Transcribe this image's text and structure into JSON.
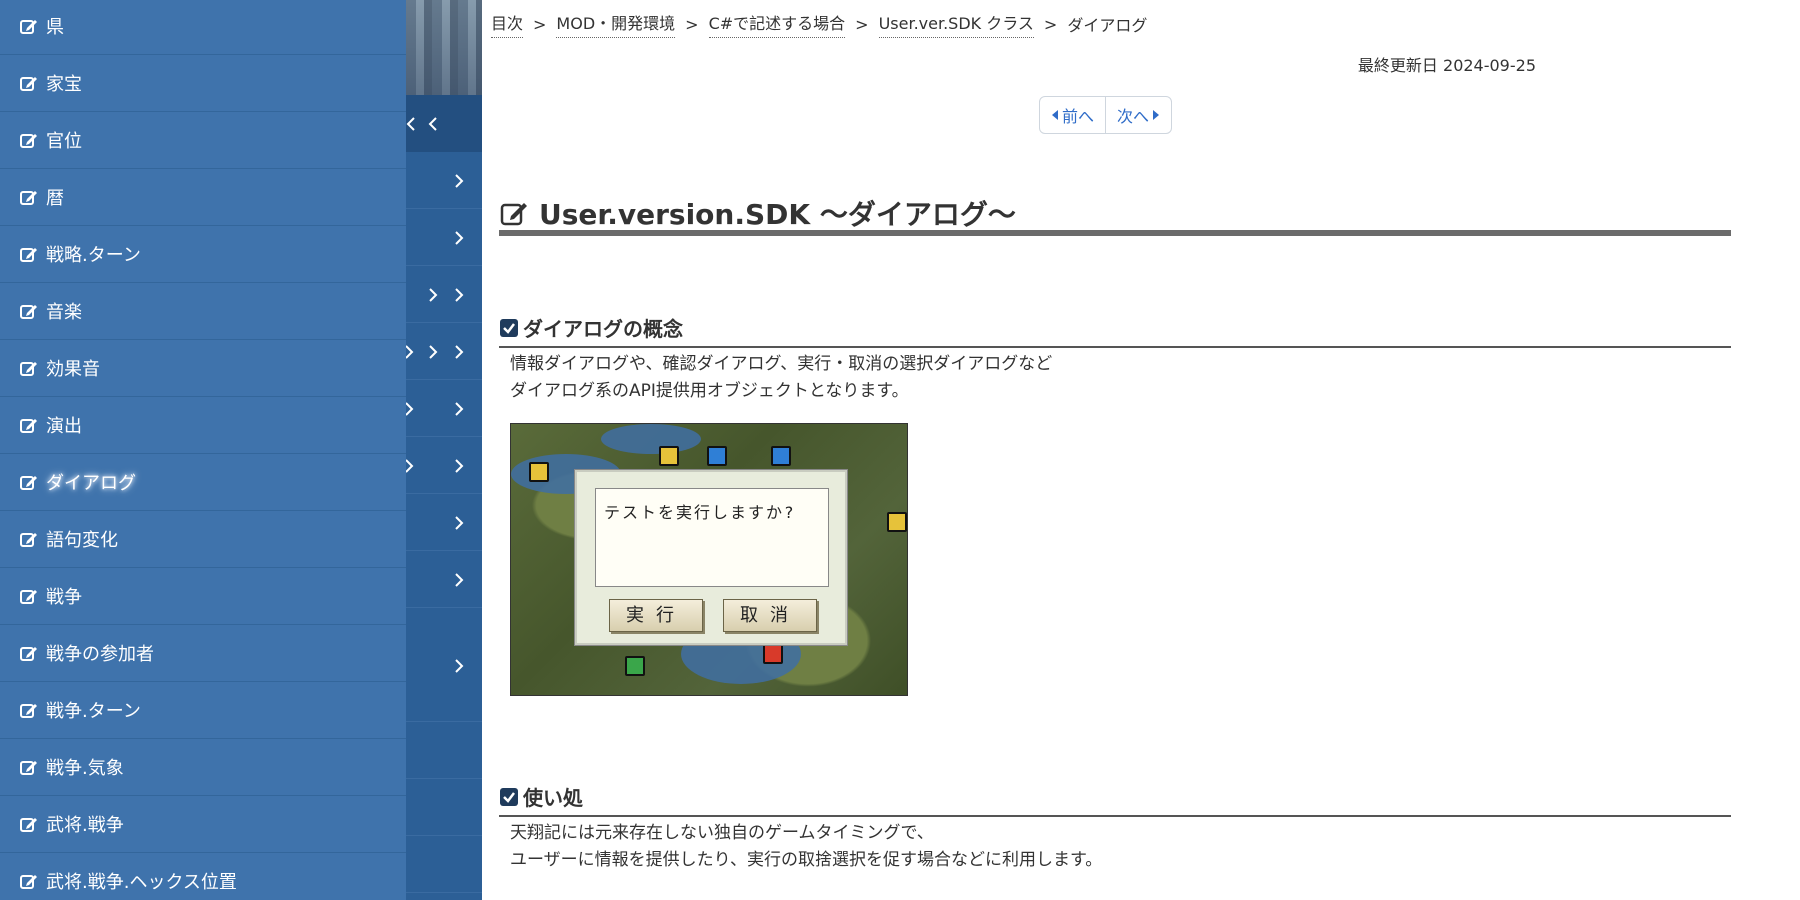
{
  "sidebar": {
    "items": [
      {
        "label": "県"
      },
      {
        "label": "家宝"
      },
      {
        "label": "官位"
      },
      {
        "label": "暦"
      },
      {
        "label": "戦略.ターン"
      },
      {
        "label": "音楽"
      },
      {
        "label": "効果音"
      },
      {
        "label": "演出"
      },
      {
        "label": "ダイアログ",
        "active": true
      },
      {
        "label": "語句変化"
      },
      {
        "label": "戦争"
      },
      {
        "label": "戦争の参加者"
      },
      {
        "label": "戦争.ターン"
      },
      {
        "label": "戦争.気象"
      },
      {
        "label": "武将.戦争"
      },
      {
        "label": "武将.戦争.ヘックス位置"
      }
    ]
  },
  "breadcrumb": {
    "items": [
      "目次",
      "MOD・開発環境",
      "C#で記述する場合",
      "User.ver.SDK クラス"
    ],
    "current": "ダイアログ",
    "separator": ">"
  },
  "updated": "最終更新日 2024-09-25",
  "pager": {
    "prev": "前へ",
    "next": "次へ"
  },
  "title": "User.version.SDK 〜ダイアログ〜",
  "sections": [
    {
      "heading": "ダイアログの概念",
      "lines": [
        "情報ダイアログや、確認ダイアログ、実行・取消の選択ダイアログなど",
        "ダイアログ系のAPI提供用オブジェクトとなります。"
      ]
    },
    {
      "heading": "使い処",
      "lines": [
        "天翔記には元来存在しない独自のゲームタイミングで、",
        "ユーザーに情報を提供したり、実行の取捨選択を促す場合などに利用します。"
      ]
    }
  ],
  "game_dialog": {
    "message": "テストを実行しますか?",
    "ok": "実行",
    "cancel": "取消"
  },
  "colors": {
    "sidebar_bg": "#3f73ac",
    "subnav_bg": "#2c5f96",
    "link_blue": "#2f6cc8",
    "rule_gray": "#6b6b6b"
  }
}
